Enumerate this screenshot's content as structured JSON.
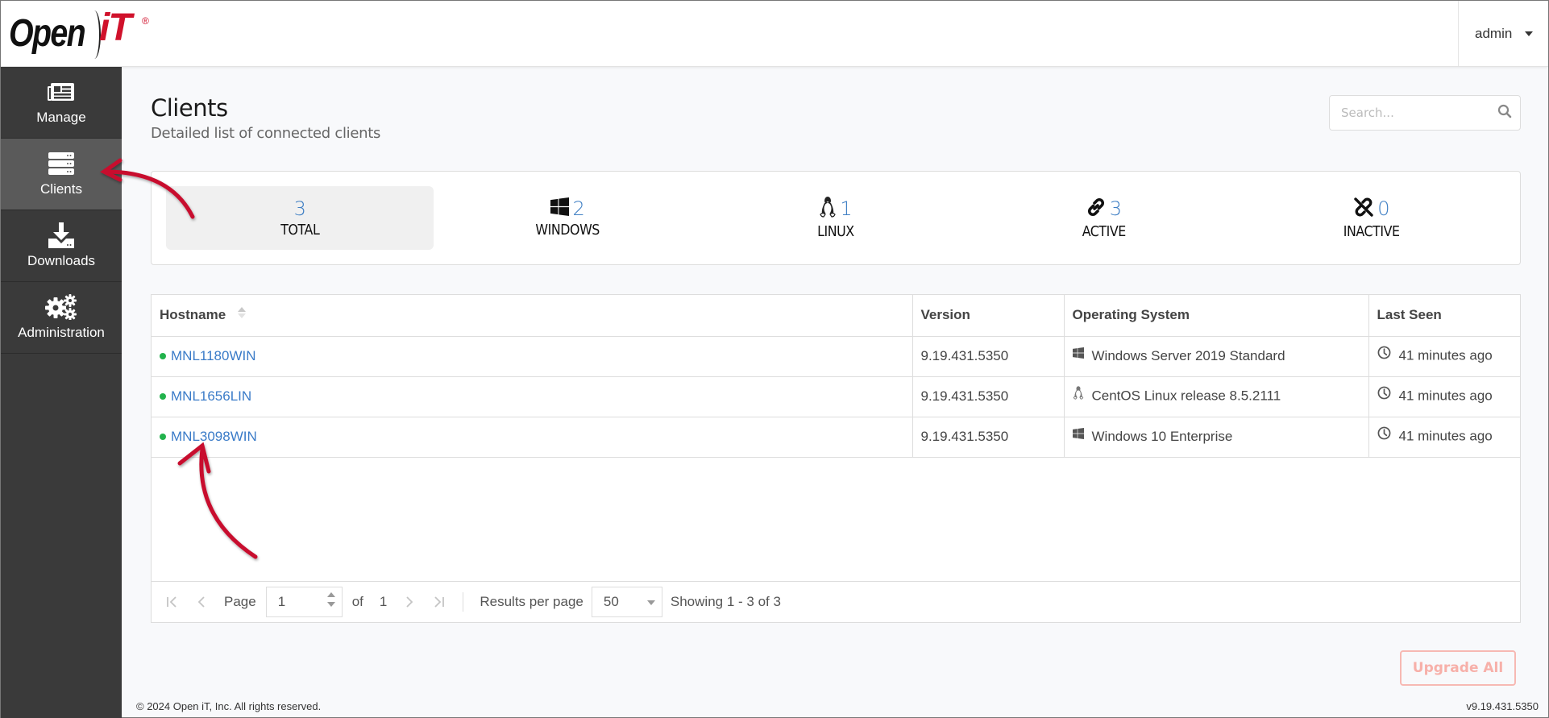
{
  "header": {
    "logo": {
      "part1": "Open",
      "part2": "iT",
      "reg": "®"
    },
    "user": {
      "name": "admin",
      "caret_icon": "caret-down-icon"
    }
  },
  "sidebar": {
    "items": [
      {
        "label": "Manage",
        "icon": "newspaper-icon",
        "active": false
      },
      {
        "label": "Clients",
        "icon": "server-icon",
        "active": true
      },
      {
        "label": "Downloads",
        "icon": "download-icon",
        "active": false
      },
      {
        "label": "Administration",
        "icon": "gears-icon",
        "active": false
      }
    ]
  },
  "page": {
    "title": "Clients",
    "subtitle": "Detailed list of connected clients"
  },
  "search": {
    "placeholder": "Search...",
    "value": "",
    "icon": "search-icon"
  },
  "stats": [
    {
      "value": "3",
      "label": "TOTAL",
      "icon": null,
      "active": true
    },
    {
      "value": "2",
      "label": "WINDOWS",
      "icon": "windows-icon",
      "active": false
    },
    {
      "value": "1",
      "label": "LINUX",
      "icon": "linux-icon",
      "active": false
    },
    {
      "value": "3",
      "label": "ACTIVE",
      "icon": "link-icon",
      "active": false
    },
    {
      "value": "0",
      "label": "INACTIVE",
      "icon": "unlink-icon",
      "active": false
    }
  ],
  "table": {
    "columns": [
      "Hostname",
      "Version",
      "Operating System",
      "Last Seen"
    ],
    "rows": [
      {
        "hostname": "MNL1180WIN",
        "status": "online",
        "version": "9.19.431.5350",
        "os": "Windows Server 2019 Standard",
        "os_icon": "windows-icon",
        "last_seen": "41 minutes ago"
      },
      {
        "hostname": "MNL1656LIN",
        "status": "online",
        "version": "9.19.431.5350",
        "os": "CentOS Linux release 8.5.2111",
        "os_icon": "linux-icon",
        "last_seen": "41 minutes ago"
      },
      {
        "hostname": "MNL3098WIN",
        "status": "online",
        "version": "9.19.431.5350",
        "os": "Windows 10 Enterprise",
        "os_icon": "windows-icon",
        "last_seen": "41 minutes ago"
      }
    ]
  },
  "pager": {
    "page_label": "Page",
    "page_value": "1",
    "of_label": "of",
    "total_pages": "1",
    "rpp_label": "Results per page",
    "rpp_value": "50",
    "showing": "Showing 1 - 3 of 3"
  },
  "actions": {
    "upgrade_all": "Upgrade All"
  },
  "footer": {
    "copyright": "© 2024 Open iT, Inc. All rights reserved.",
    "version": "v9.19.431.5350"
  },
  "colors": {
    "brand_red": "#d0112b",
    "link_blue": "#3a7bc8",
    "online_green": "#22b24c",
    "sidebar_bg": "#3a3a3a",
    "sidebar_active": "#5a5a5a",
    "upgrade_disabled": "#f7b0a9"
  }
}
